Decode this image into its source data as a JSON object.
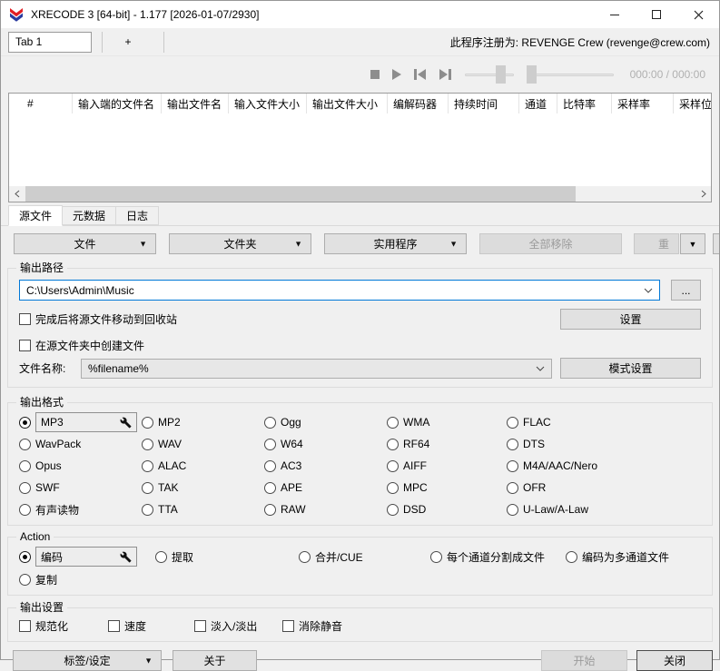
{
  "window": {
    "title": "XRECODE 3 [64-bit] - 1.177 [2026-01-07/2930]",
    "registered_text": "此程序注册为: REVENGE Crew (revenge@crew.com)"
  },
  "icons": {
    "dropdown": "▼"
  },
  "colors": {
    "accent_focus": "#0078d7",
    "logo_red": "#e31e24",
    "logo_blue": "#2a3b9f"
  },
  "tab_bar": {
    "tab1_label": "Tab 1",
    "add_tab_label": "+"
  },
  "player": {
    "time_display": "000:00 / 000:00"
  },
  "file_table": {
    "columns": [
      "#",
      "输入端的文件名",
      "输出文件名",
      "输入文件大小",
      "输出文件大小",
      "编解码器",
      "持续时间",
      "通道",
      "比特率",
      "采样率",
      "采样位数"
    ],
    "rows": []
  },
  "view_tabs": {
    "source": "源文件",
    "metadata": "元数据",
    "log": "日志",
    "active": "源文件"
  },
  "toolbar": {
    "file": "文件",
    "folder": "文件夹",
    "utilities": "实用程序",
    "remove_all": "全部移除",
    "clipped": "重"
  },
  "output_path": {
    "group_label": "输出路径",
    "path_value": "C:\\Users\\Admin\\Music",
    "browse_label": "...",
    "move_to_recycle_label": "完成后将源文件移动到回收站",
    "settings_label": "设置",
    "create_in_source_label": "在源文件夹中创建文件",
    "filename_label": "文件名称:",
    "filename_pattern": "%filename%",
    "pattern_settings_label": "模式设置"
  },
  "output_format": {
    "group_label": "输出格式",
    "selected": "MP3",
    "rows": [
      [
        "MP3",
        "MP2",
        "Ogg",
        "WMA",
        "FLAC"
      ],
      [
        "WavPack",
        "WAV",
        "W64",
        "RF64",
        "DTS"
      ],
      [
        "Opus",
        "ALAC",
        "AC3",
        "AIFF",
        "M4A/AAC/Nero"
      ],
      [
        "SWF",
        "TAK",
        "APE",
        "MPC",
        "OFR"
      ],
      [
        "有声读物",
        "TTA",
        "RAW",
        "DSD",
        "U-Law/A-Law"
      ]
    ]
  },
  "action": {
    "group_label": "Action",
    "selected": "编码",
    "encode": "编码",
    "extract": "提取",
    "merge_cue": "合并/CUE",
    "split_channels": "每个通道分割成文件",
    "multichannel": "编码为多通道文件",
    "copy": "复制"
  },
  "output_settings": {
    "group_label": "输出设置",
    "normalize": "规范化",
    "speed": "速度",
    "fade": "淡入/淡出",
    "remove_silence": "消除静音"
  },
  "footer": {
    "tags_settings": "标签/设定",
    "about": "关于",
    "start": "开始",
    "close": "关闭"
  }
}
